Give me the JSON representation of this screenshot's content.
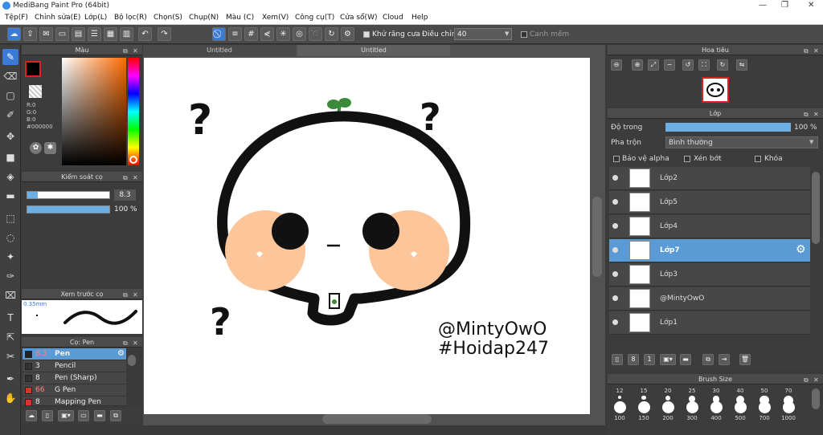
{
  "window": {
    "title": "MediBang Paint Pro (64bit)"
  },
  "menu": [
    "Tệp(F)",
    "Chỉnh sửa(E)",
    "Lớp(L)",
    "Bộ lọc(R)",
    "Chọn(S)",
    "Chụp(N)",
    "Màu (C)",
    "Xem(V)",
    "Công cụ(T)",
    "Cửa sổ(W)",
    "Cloud",
    "Help"
  ],
  "toolbar": {
    "antialias_label": "Khử răng cưa",
    "adjust_label": "Điều chỉnh",
    "adjust_value": "40",
    "smooth_label": "Canh mềm"
  },
  "color_panel": {
    "title": "Màu",
    "r": "R:0",
    "g": "G:0",
    "b": "B:0",
    "hex": "#000000"
  },
  "brush_control": {
    "title": "Kiểm soát cọ",
    "size": "8.3",
    "opacity": "100 %",
    "size_fraction": 0.9,
    "opacity_fraction": 1.0
  },
  "brush_preview": {
    "title": "Xem trước cọ",
    "size": "0.35mm"
  },
  "brush_list": {
    "title": "Cọ: Pen",
    "items": [
      {
        "size": "8.3",
        "name": "Pen",
        "color": "#222222"
      },
      {
        "size": "3",
        "name": "Pencil",
        "color": "#333333"
      },
      {
        "size": "8",
        "name": "Pen (Sharp)",
        "color": "#333333"
      },
      {
        "size": "66",
        "name": "G Pen",
        "color": "#e03030"
      },
      {
        "size": "8",
        "name": "Mapping Pen",
        "color": "#e03030"
      }
    ]
  },
  "tabs": [
    "Untitled",
    "Untitled"
  ],
  "canvas": {
    "text1": "@MintyOwO",
    "text2": "#Hoidap247"
  },
  "navigator": {
    "title": "Hoa tiêu"
  },
  "layer_panel": {
    "title": "Lớp",
    "opacity_label": "Độ trong",
    "opacity_value": "100 %",
    "opacity_fraction": 1.0,
    "blend_label": "Pha trộn",
    "blend_value": "Bình thường",
    "protect_alpha": "Bảo vệ alpha",
    "clipping": "Xén bớt",
    "lock": "Khóa",
    "layers": [
      {
        "name": "Lớp2"
      },
      {
        "name": "Lớp5"
      },
      {
        "name": "Lớp4"
      },
      {
        "name": "Lớp7"
      },
      {
        "name": "Lớp3"
      },
      {
        "name": "@MintyOwO"
      },
      {
        "name": "Lớp1"
      }
    ]
  },
  "brush_size_panel": {
    "title": "Brush Size",
    "row1": [
      "12",
      "15",
      "20",
      "25",
      "30",
      "40",
      "50",
      "70"
    ],
    "row2": [
      "100",
      "150",
      "200",
      "300",
      "400",
      "500",
      "700",
      "1000"
    ]
  }
}
